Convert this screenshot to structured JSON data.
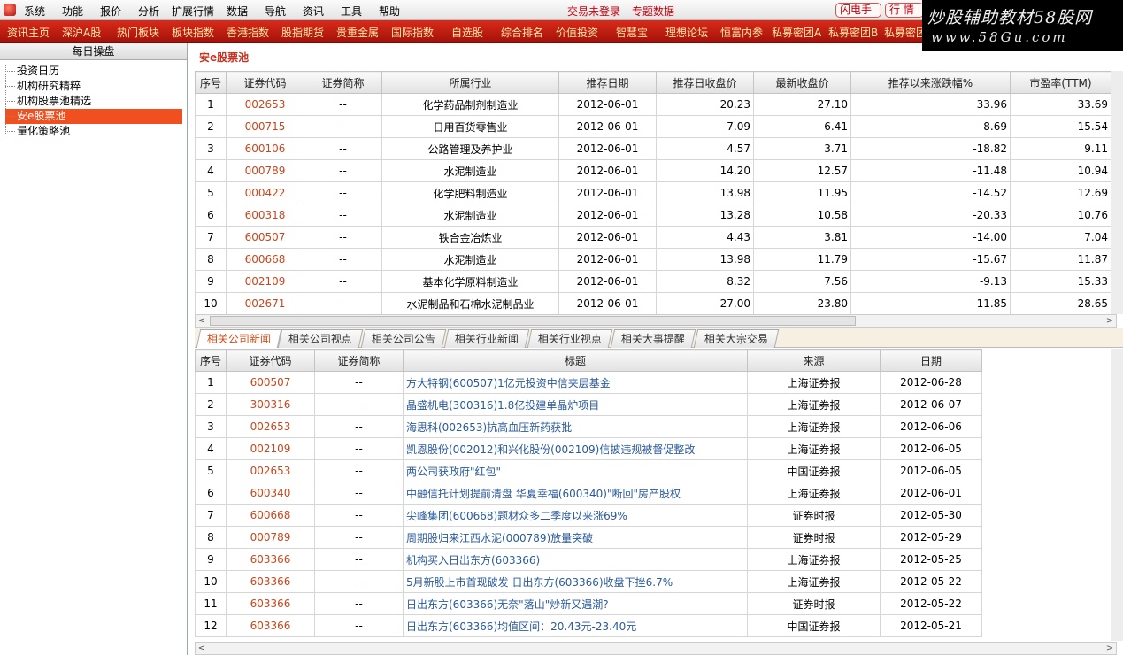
{
  "menu": {
    "items": [
      "系统",
      "功能",
      "报价",
      "分析",
      "扩展行情",
      "数据",
      "导航",
      "资讯",
      "工具",
      "帮助"
    ],
    "trade_status": "交易未登录",
    "special_data": "专题数据",
    "flash_btn": "闪电手",
    "market_btn": "行 情"
  },
  "brand": {
    "title": "炒股辅助教材58股网",
    "url": "www.58Gu.com"
  },
  "navbar": {
    "items": [
      "资讯主页",
      "深沪A股",
      "热门板块",
      "板块指数",
      "香港指数",
      "股指期货",
      "贵重金属",
      "国际指数",
      "自选股",
      "综合排名",
      "价值投资",
      "智慧宝",
      "理想论坛",
      "恒富内参",
      "私募密团A",
      "私募密团B",
      "私募密团"
    ]
  },
  "sidebar": {
    "title": "每日操盘",
    "items": [
      "投资日历",
      "机构研究精粹",
      "机构股票池精选",
      "安e股票池",
      "量化策略池"
    ],
    "selected_index": 3
  },
  "pool": {
    "title": "安e股票池",
    "columns": [
      "序号",
      "证券代码",
      "证券简称",
      "所属行业",
      "推荐日期",
      "推荐日收盘价",
      "最新收盘价",
      "推荐以来涨跌幅%",
      "市盈率(TTM)"
    ],
    "rows": [
      [
        "1",
        "002653",
        "--",
        "化学药品制剂制造业",
        "2012-06-01",
        "20.23",
        "27.10",
        "33.96",
        "33.69"
      ],
      [
        "2",
        "000715",
        "--",
        "日用百货零售业",
        "2012-06-01",
        "7.09",
        "6.41",
        "-8.69",
        "15.54"
      ],
      [
        "3",
        "600106",
        "--",
        "公路管理及养护业",
        "2012-06-01",
        "4.57",
        "3.71",
        "-18.82",
        "9.11"
      ],
      [
        "4",
        "000789",
        "--",
        "水泥制造业",
        "2012-06-01",
        "14.20",
        "12.57",
        "-11.48",
        "10.94"
      ],
      [
        "5",
        "000422",
        "--",
        "化学肥料制造业",
        "2012-06-01",
        "13.98",
        "11.95",
        "-14.52",
        "12.69"
      ],
      [
        "6",
        "600318",
        "--",
        "水泥制造业",
        "2012-06-01",
        "13.28",
        "10.58",
        "-20.33",
        "10.76"
      ],
      [
        "7",
        "600507",
        "--",
        "铁合金冶炼业",
        "2012-06-01",
        "4.43",
        "3.81",
        "-14.00",
        "7.04"
      ],
      [
        "8",
        "600668",
        "--",
        "水泥制造业",
        "2012-06-01",
        "13.98",
        "11.79",
        "-15.67",
        "11.87"
      ],
      [
        "9",
        "002109",
        "--",
        "基本化学原料制造业",
        "2012-06-01",
        "8.32",
        "7.56",
        "-9.13",
        "15.33"
      ],
      [
        "10",
        "002671",
        "--",
        "水泥制品和石棉水泥制品业",
        "2012-06-01",
        "27.00",
        "23.80",
        "-11.85",
        "28.65"
      ]
    ]
  },
  "tabs": [
    "相关公司新闻",
    "相关公司视点",
    "相关公司公告",
    "相关行业新闻",
    "相关行业视点",
    "相关大事提醒",
    "相关大宗交易"
  ],
  "news": {
    "columns": [
      "序号",
      "证券代码",
      "证券简称",
      "标题",
      "来源",
      "日期"
    ],
    "rows": [
      [
        "1",
        "600507",
        "--",
        "方大特钢(600507)1亿元投资中信夹层基金",
        "上海证券报",
        "2012-06-28"
      ],
      [
        "2",
        "300316",
        "--",
        "晶盛机电(300316)1.8亿投建单晶炉项目",
        "上海证券报",
        "2012-06-07"
      ],
      [
        "3",
        "002653",
        "--",
        "海思科(002653)抗高血压新药获批",
        "上海证券报",
        "2012-06-06"
      ],
      [
        "4",
        "002109",
        "--",
        "凯恩股份(002012)和兴化股份(002109)信披违规被督促整改",
        "上海证券报",
        "2012-06-05"
      ],
      [
        "5",
        "002653",
        "--",
        "两公司获政府\"红包\"",
        "中国证券报",
        "2012-06-05"
      ],
      [
        "6",
        "600340",
        "--",
        "中融信托计划提前清盘 华夏幸福(600340)\"断回\"房产股权",
        "上海证券报",
        "2012-06-01"
      ],
      [
        "7",
        "600668",
        "--",
        "尖峰集团(600668)题材众多二季度以来涨69%",
        "证券时报",
        "2012-05-30"
      ],
      [
        "8",
        "000789",
        "--",
        "周期股归来江西水泥(000789)放量突破",
        "证券时报",
        "2012-05-29"
      ],
      [
        "9",
        "603366",
        "--",
        "机构买入日出东方(603366)",
        "上海证券报",
        "2012-05-25"
      ],
      [
        "10",
        "603366",
        "--",
        "5月新股上市首现破发 日出东方(603366)收盘下挫6.7%",
        "上海证券报",
        "2012-05-22"
      ],
      [
        "11",
        "603366",
        "--",
        "日出东方(603366)无奈\"落山\"炒新又遇潮?",
        "证券时报",
        "2012-05-22"
      ],
      [
        "12",
        "603366",
        "--",
        "日出东方(603366)均值区间：20.43元-23.40元",
        "中国证券报",
        "2012-05-21"
      ]
    ]
  }
}
